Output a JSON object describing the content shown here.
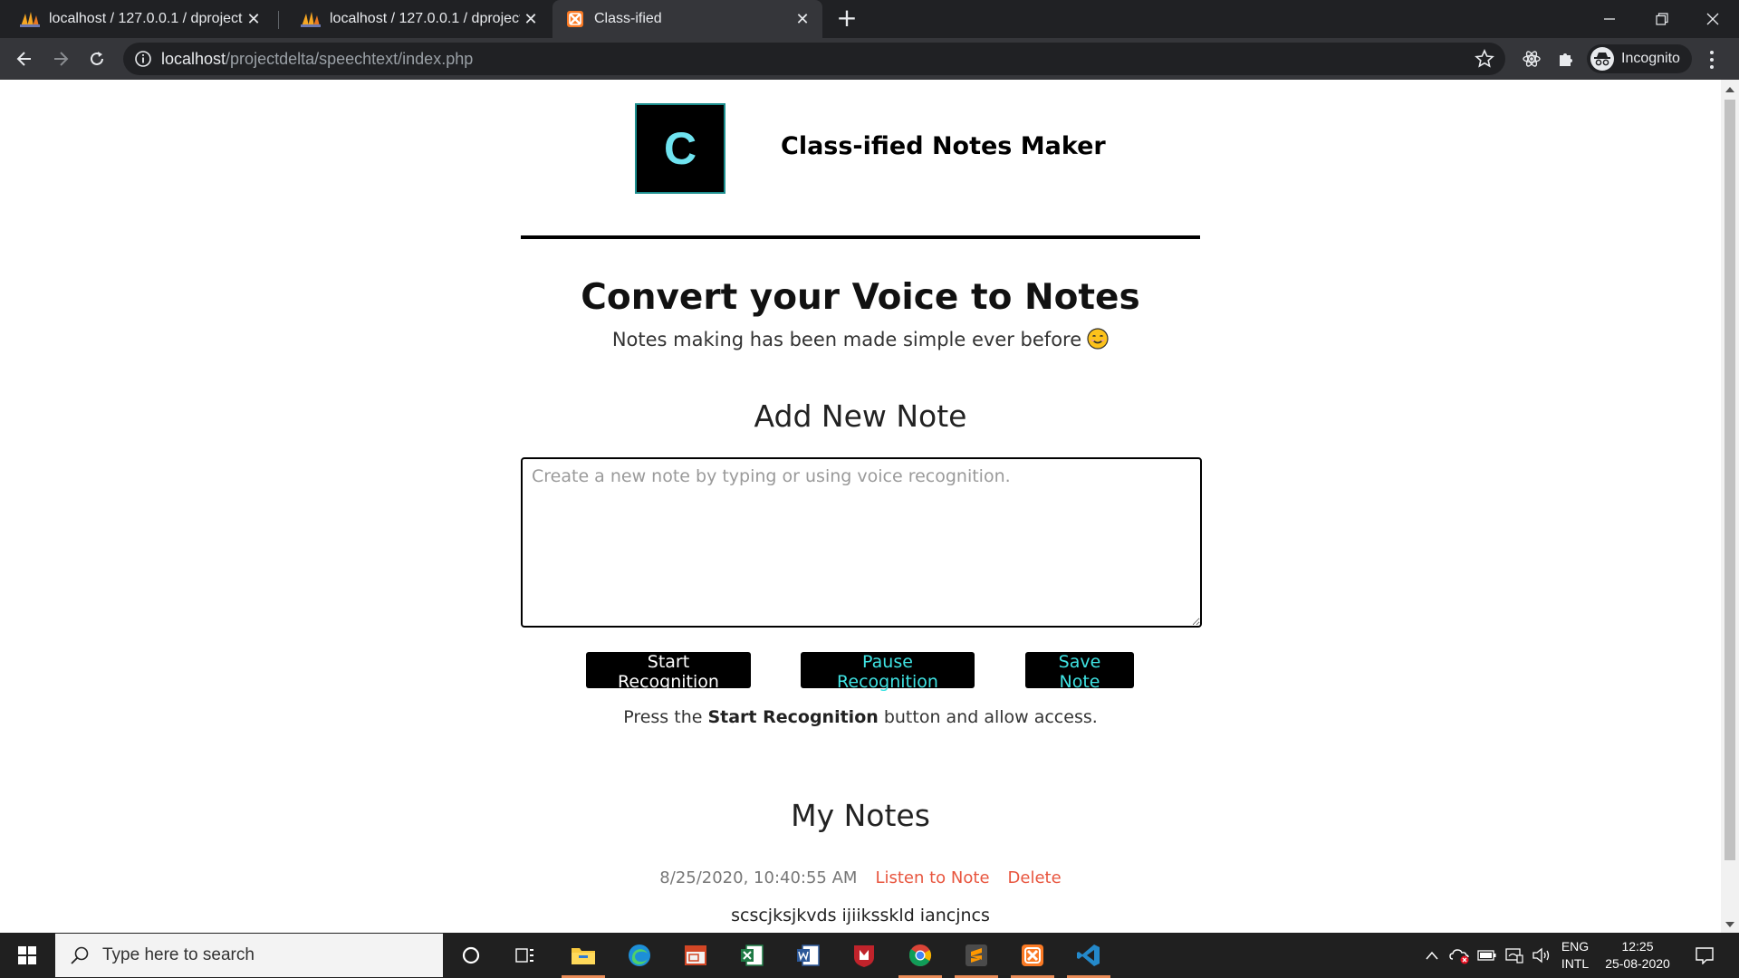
{
  "browser": {
    "tabs": [
      {
        "title": "localhost / 127.0.0.1 / dproject / ",
        "icon": "phpmyadmin-icon"
      },
      {
        "title": "localhost / 127.0.0.1 / dproject / ",
        "icon": "phpmyadmin-icon"
      },
      {
        "title": "Class-ified",
        "icon": "xampp-icon",
        "active": true
      }
    ],
    "url_host": "localhost",
    "url_path": "/projectdelta/speechtext/index.php",
    "profile_label": "Incognito"
  },
  "page": {
    "logo_letter": "C",
    "site_name": "Class-ified Notes Maker",
    "heading": "Convert your Voice to Notes",
    "subtitle": "Notes making has been made simple ever before",
    "add_note_heading": "Add New Note",
    "note_placeholder": "Create a new note by typing or using voice recognition.",
    "note_value": "",
    "buttons": {
      "start": "Start Recognition",
      "pause": "Pause Recognition",
      "save": "Save Note"
    },
    "hint_prefix": "Press the ",
    "hint_bold": "Start Recognition",
    "hint_suffix": " button and allow access.",
    "my_notes_heading": "My Notes",
    "notes": [
      {
        "date": "8/25/2020, 10:40:55 AM",
        "listen_label": "Listen to Note",
        "delete_label": "Delete",
        "content": "scscjksjkvds ijiiksskld iancjncs"
      }
    ]
  },
  "taskbar": {
    "search_placeholder": "Type here to search",
    "language_top": "ENG",
    "language_bottom": "INTL",
    "time": "12:25",
    "date": "25-08-2020"
  },
  "colors": {
    "accent_cyan": "#3fe3e3",
    "link_red": "#e8553e",
    "chrome_dark": "#202124",
    "chrome_mid": "#35363a"
  }
}
